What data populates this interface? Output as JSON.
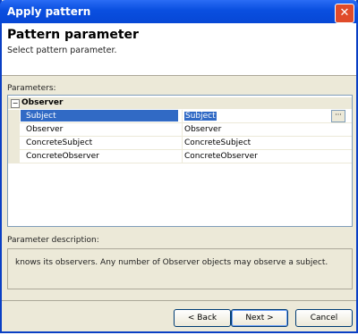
{
  "window": {
    "title": "Apply pattern",
    "close_glyph": "✕"
  },
  "header": {
    "title": "Pattern parameter",
    "subtitle": "Select pattern parameter."
  },
  "parameters": {
    "label": "Parameters:",
    "group": {
      "expander": "−",
      "name": "Observer"
    },
    "rows": [
      {
        "name": "Subject",
        "value": "Subject",
        "selected": true
      },
      {
        "name": "Observer",
        "value": "Observer"
      },
      {
        "name": "ConcreteSubject",
        "value": "ConcreteSubject"
      },
      {
        "name": "ConcreteObserver",
        "value": "ConcreteObserver"
      }
    ],
    "ellipsis": "···"
  },
  "description": {
    "label": "Parameter description:",
    "text": "knows its observers. Any number of Observer objects may observe a subject."
  },
  "buttons": {
    "back": "< Back",
    "next": "Next >",
    "cancel": "Cancel"
  }
}
